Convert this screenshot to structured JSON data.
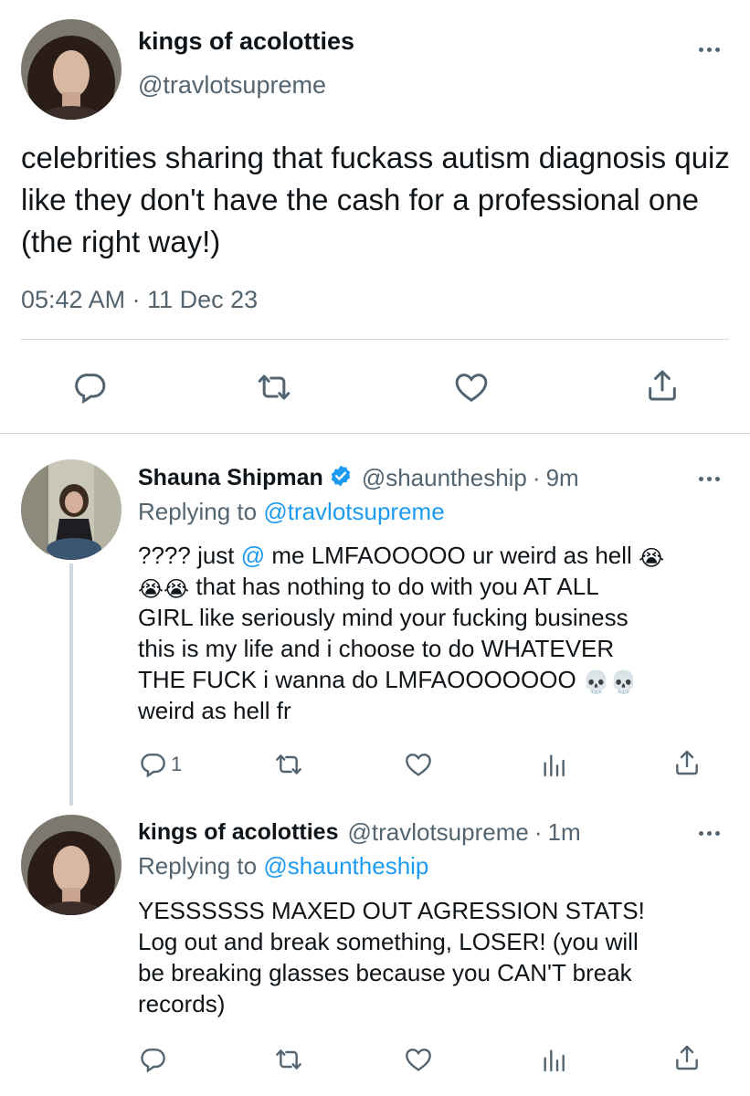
{
  "main_tweet": {
    "author_name": "kings of acolotties",
    "author_handle": "@travlotsupreme",
    "text": "celebrities sharing that fuckass autism diagnosis quiz like they don't have the cash for a professional one (the right way!)",
    "time": "05:42 AM",
    "separator": "·",
    "date": "11 Dec 23"
  },
  "reply1": {
    "author_name": "Shauna Shipman",
    "author_handle": "@shauntheship",
    "separator": "·",
    "age": "9m",
    "replying_label": "Replying to",
    "replying_handle": "@travlotsupreme",
    "text_lines": [
      "???? just ",
      "@",
      " me LMFAOOOOO ur weird as hell",
      " that has nothing to do with you AT ALL",
      "GIRL like seriously mind your fucking business",
      "this is my life and i choose to do WHATEVER",
      "THE FUCK i wanna do LMFAOOOOOOO",
      "weird as hell fr"
    ],
    "reply_count": "1",
    "verified": true
  },
  "reply2": {
    "author_name": "kings of acolotties",
    "author_handle": "@travlotsupreme",
    "separator": "·",
    "age": "1m",
    "replying_label": "Replying to",
    "replying_handle": "@shauntheship",
    "text_lines": [
      "YESSSSSS MAXED OUT AGRESSION STATS!",
      "Log out and break something, LOSER! (you will",
      "be breaking glasses because you CAN'T break",
      "records)"
    ]
  },
  "emojis": {
    "crying": "😭",
    "skull": "💀"
  },
  "icons": [
    "reply-icon",
    "retweet-icon",
    "like-icon",
    "share-icon",
    "views-icon",
    "more-icon",
    "verified-badge-icon"
  ],
  "colors": {
    "accent": "#1d9bf0",
    "text": "#0f1419",
    "secondary": "#536471",
    "divider": "#cfd9de"
  }
}
